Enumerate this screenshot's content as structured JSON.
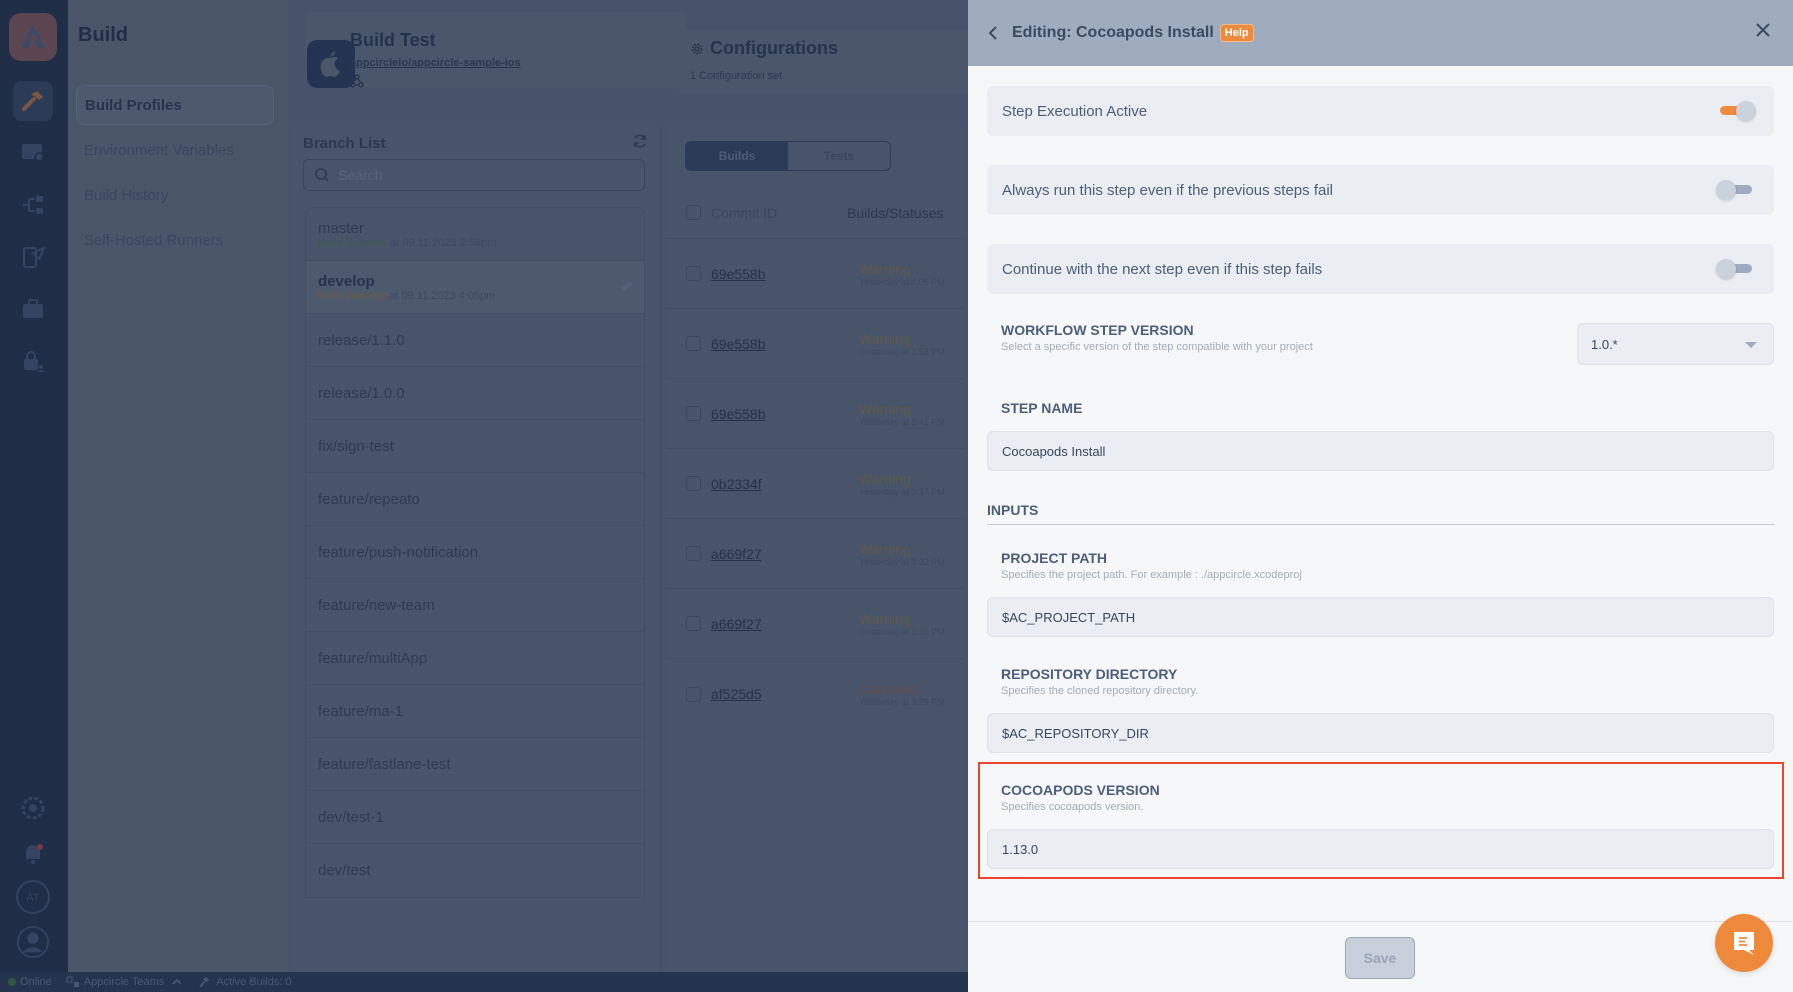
{
  "rail": {
    "icons": [
      "appcircle-logo",
      "build-hammer-icon",
      "signing-certificate-icon",
      "workflow-icon",
      "distribution-icon",
      "enterprise-store-icon",
      "testing-portal-lock-icon",
      "integrations-icon",
      "notifications-bell-icon",
      "organization-avatar",
      "user-profile-icon"
    ],
    "avatar_initials": "AT",
    "colors": {
      "brand": "#ef8a3c"
    }
  },
  "subnav": {
    "title": "Build",
    "items": [
      {
        "label": "Build Profiles",
        "active": true
      },
      {
        "label": "Environment Variables",
        "active": false
      },
      {
        "label": "Build History",
        "active": false
      },
      {
        "label": "Self-Hosted Runners",
        "active": false
      }
    ]
  },
  "project": {
    "title": "Build Test",
    "repo": "appcircleio/appcircle-sample-ios",
    "platform_icon": "apple-icon"
  },
  "branch_list": {
    "title": "Branch List",
    "search_placeholder": "Search",
    "branches": [
      {
        "name": "master",
        "status": "Build Success",
        "status_time": " at 09.11.2023 2:58pm"
      },
      {
        "name": "develop",
        "status": "Build Warning",
        "status_time": " at 09.11.2023 4:05pm",
        "active": true
      },
      {
        "name": "release/1.1.0"
      },
      {
        "name": "release/1.0.0"
      },
      {
        "name": "fix/sign-test"
      },
      {
        "name": "feature/repeato"
      },
      {
        "name": "feature/push-notification"
      },
      {
        "name": "feature/new-team"
      },
      {
        "name": "feature/multiApp"
      },
      {
        "name": "feature/ma-1"
      },
      {
        "name": "feature/fastlane-test"
      },
      {
        "name": "dev/test-1"
      },
      {
        "name": "dev/test"
      }
    ]
  },
  "configurations": {
    "title": "Configurations",
    "subtitle": "1 Configuration set"
  },
  "builds": {
    "tabs": [
      "Builds",
      "Tests"
    ],
    "active_tab": "Builds",
    "columns": [
      "Commit ID",
      "Builds/Statuses"
    ],
    "rows": [
      {
        "commit": "69e558b",
        "status": "Warning",
        "time": "Yesterday at 4:05 PM"
      },
      {
        "commit": "69e558b",
        "status": "Warning",
        "time": "Yesterday at 3:58 PM"
      },
      {
        "commit": "69e558b",
        "status": "Warning",
        "time": "Yesterday at 3:41 PM"
      },
      {
        "commit": "0b2334f",
        "status": "Warning",
        "time": "Yesterday at 3:37 PM"
      },
      {
        "commit": "a669f27",
        "status": "Warning",
        "time": "Yesterday at 3:32 PM"
      },
      {
        "commit": "a669f27",
        "status": "Warning",
        "time": "Yesterday at 3:30 PM"
      },
      {
        "commit": "af525d5",
        "status": "Canceled",
        "time": "Yesterday at 3:29 PM"
      }
    ]
  },
  "statusbar": {
    "online": "Online",
    "team": "Appcircle Teams",
    "active_builds": "Active Builds: 0"
  },
  "drawer": {
    "title": "Editing: Cocoapods Install",
    "help_label": "Help",
    "toggles": [
      {
        "label": "Step Execution Active",
        "on": true
      },
      {
        "label": "Always run this step even if the previous steps fail",
        "on": false
      },
      {
        "label": "Continue with the next step even if this step fails",
        "on": false
      }
    ],
    "workflow_step_version": {
      "label": "WORKFLOW STEP VERSION",
      "help": "Select a specific version of the step compatible with your project",
      "value": "1.0.*"
    },
    "step_name": {
      "label": "STEP NAME",
      "value": "Cocoapods Install"
    },
    "inputs_heading": "INPUTS",
    "project_path": {
      "label": "PROJECT PATH",
      "help": "Specifies the project path. For example : ./appcircle.xcodeproj",
      "value": "$AC_PROJECT_PATH"
    },
    "repository_directory": {
      "label": "REPOSITORY DIRECTORY",
      "help": "Specifies the cloned repository directory.",
      "value": "$AC_REPOSITORY_DIR"
    },
    "cocoapods_version": {
      "label": "COCOAPODS VERSION",
      "help": "Specifies cocoapods version.",
      "value": "1.13.0"
    },
    "save_label": "Save",
    "highlight_color": "#e8472b"
  }
}
